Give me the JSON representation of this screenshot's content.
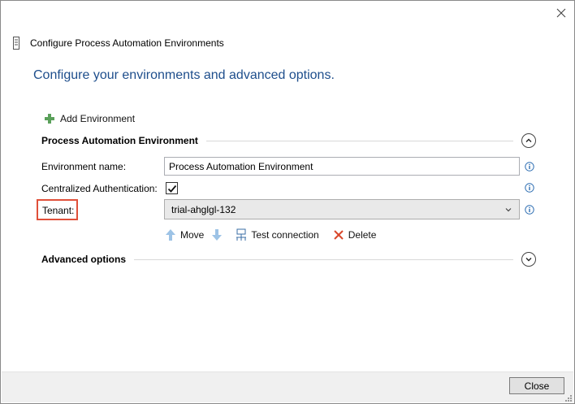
{
  "window": {
    "title": "Configure Process Automation Environments"
  },
  "heading": "Configure your environments and advanced options.",
  "toolbar": {
    "add_environment_label": "Add Environment"
  },
  "environment_section": {
    "title": "Process Automation Environment",
    "expanded": true,
    "fields": {
      "environment_name_label": "Environment name:",
      "environment_name_value": "Process Automation Environment",
      "centralized_auth_label": "Centralized Authentication:",
      "centralized_auth_checked": true,
      "tenant_label": "Tenant:",
      "tenant_value": "trial-ahglgl-132"
    },
    "actions": {
      "move_label": "Move",
      "test_connection_label": "Test connection",
      "delete_label": "Delete"
    }
  },
  "advanced_section": {
    "title": "Advanced options",
    "expanded": false
  },
  "footer": {
    "close_label": "Close"
  },
  "colors": {
    "heading": "#1e4e8c",
    "highlight_box": "#e0503a",
    "plus_icon": "#5aa05a",
    "arrow_icon": "#9dc3e6",
    "delete_icon": "#d9472b",
    "info_icon": "#2f6fb3"
  },
  "icons": [
    "close-icon",
    "app-icon",
    "plus-icon",
    "chevron-up-icon",
    "chevron-down-icon",
    "info-icon",
    "check-icon",
    "arrow-up-icon",
    "arrow-down-icon",
    "network-icon",
    "delete-x-icon",
    "resize-grip-icon"
  ]
}
